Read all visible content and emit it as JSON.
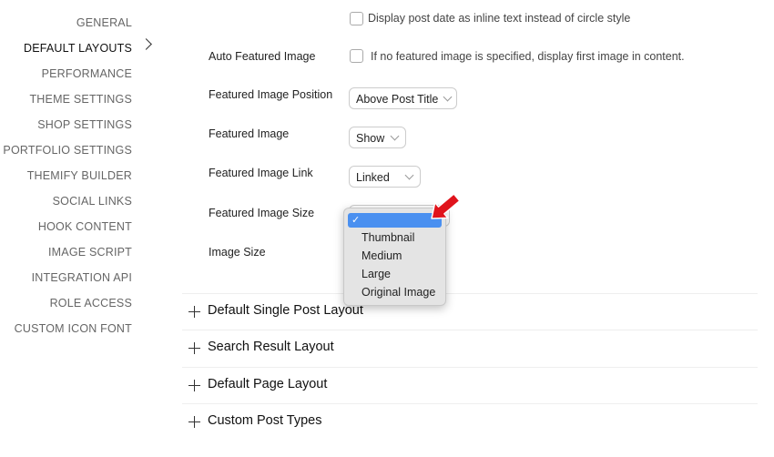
{
  "sidebar": {
    "items": [
      {
        "label": "GENERAL"
      },
      {
        "label": "DEFAULT LAYOUTS",
        "active": true
      },
      {
        "label": "PERFORMANCE"
      },
      {
        "label": "THEME SETTINGS"
      },
      {
        "label": "SHOP SETTINGS"
      },
      {
        "label": "PORTFOLIO SETTINGS"
      },
      {
        "label": "THEMIFY BUILDER"
      },
      {
        "label": "SOCIAL LINKS"
      },
      {
        "label": "HOOK CONTENT"
      },
      {
        "label": "IMAGE SCRIPT"
      },
      {
        "label": "INTEGRATION API"
      },
      {
        "label": "ROLE ACCESS"
      },
      {
        "label": "CUSTOM ICON FONT"
      }
    ]
  },
  "form": {
    "post_date_checkbox": {
      "text": "Display post date as inline text instead of circle style",
      "checked": false
    },
    "auto_featured": {
      "label": "Auto Featured Image",
      "text": "If no featured image is specified, display first image in content.",
      "checked": false
    },
    "position": {
      "label": "Featured Image Position",
      "value": "Above Post Title"
    },
    "featured": {
      "label": "Featured Image",
      "value": "Show"
    },
    "link": {
      "label": "Featured Image Link",
      "value": "Linked"
    },
    "size": {
      "label": "Featured Image Size",
      "value": ""
    },
    "image_size": {
      "label": "Image Size"
    }
  },
  "dropdown": {
    "selected_mark": "✓",
    "options": [
      "Thumbnail",
      "Medium",
      "Large",
      "Original Image"
    ]
  },
  "sections": [
    {
      "title": "Default Single Post Layout"
    },
    {
      "title": "Search Result Layout"
    },
    {
      "title": "Default Page Layout"
    },
    {
      "title": "Custom Post Types"
    }
  ],
  "annotation": {
    "arrow_color": "#e0141c"
  }
}
